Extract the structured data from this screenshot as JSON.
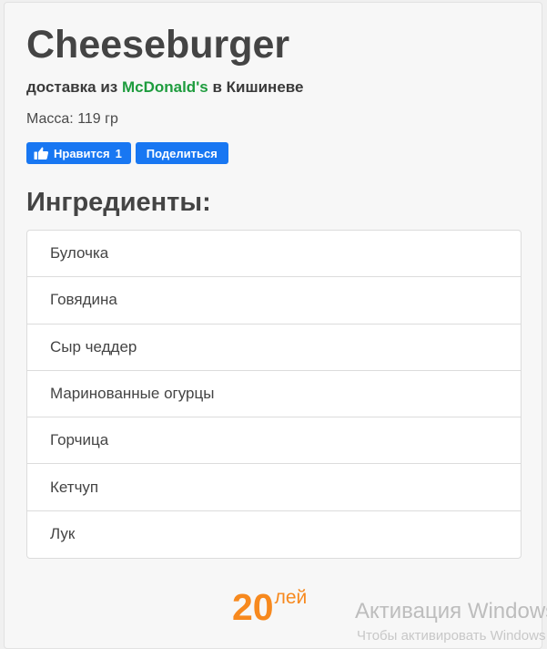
{
  "product": {
    "title": "Cheeseburger",
    "delivery_prefix": "доставка из",
    "restaurant": "McDonald's",
    "delivery_suffix": "в Кишиневе",
    "mass": "Масса: 119 гр",
    "brand_color": "#1e9c3e"
  },
  "social": {
    "like_label": "Нравится",
    "like_count": "1",
    "share_label": "Поделиться",
    "like_icon": "thumbs-up-icon",
    "button_color": "#1877f2"
  },
  "ingredients": {
    "heading": "Ингредиенты:",
    "items": [
      "Булочка",
      "Говядина",
      "Сыр чеддер",
      "Маринованные огурцы",
      "Горчица",
      "Кетчуп",
      "Лук"
    ]
  },
  "price": {
    "value": "20",
    "currency": "лей",
    "color": "#f7891e"
  },
  "os_watermark": {
    "line1": "Активация Windows",
    "line2": "Чтобы активировать Windows"
  }
}
